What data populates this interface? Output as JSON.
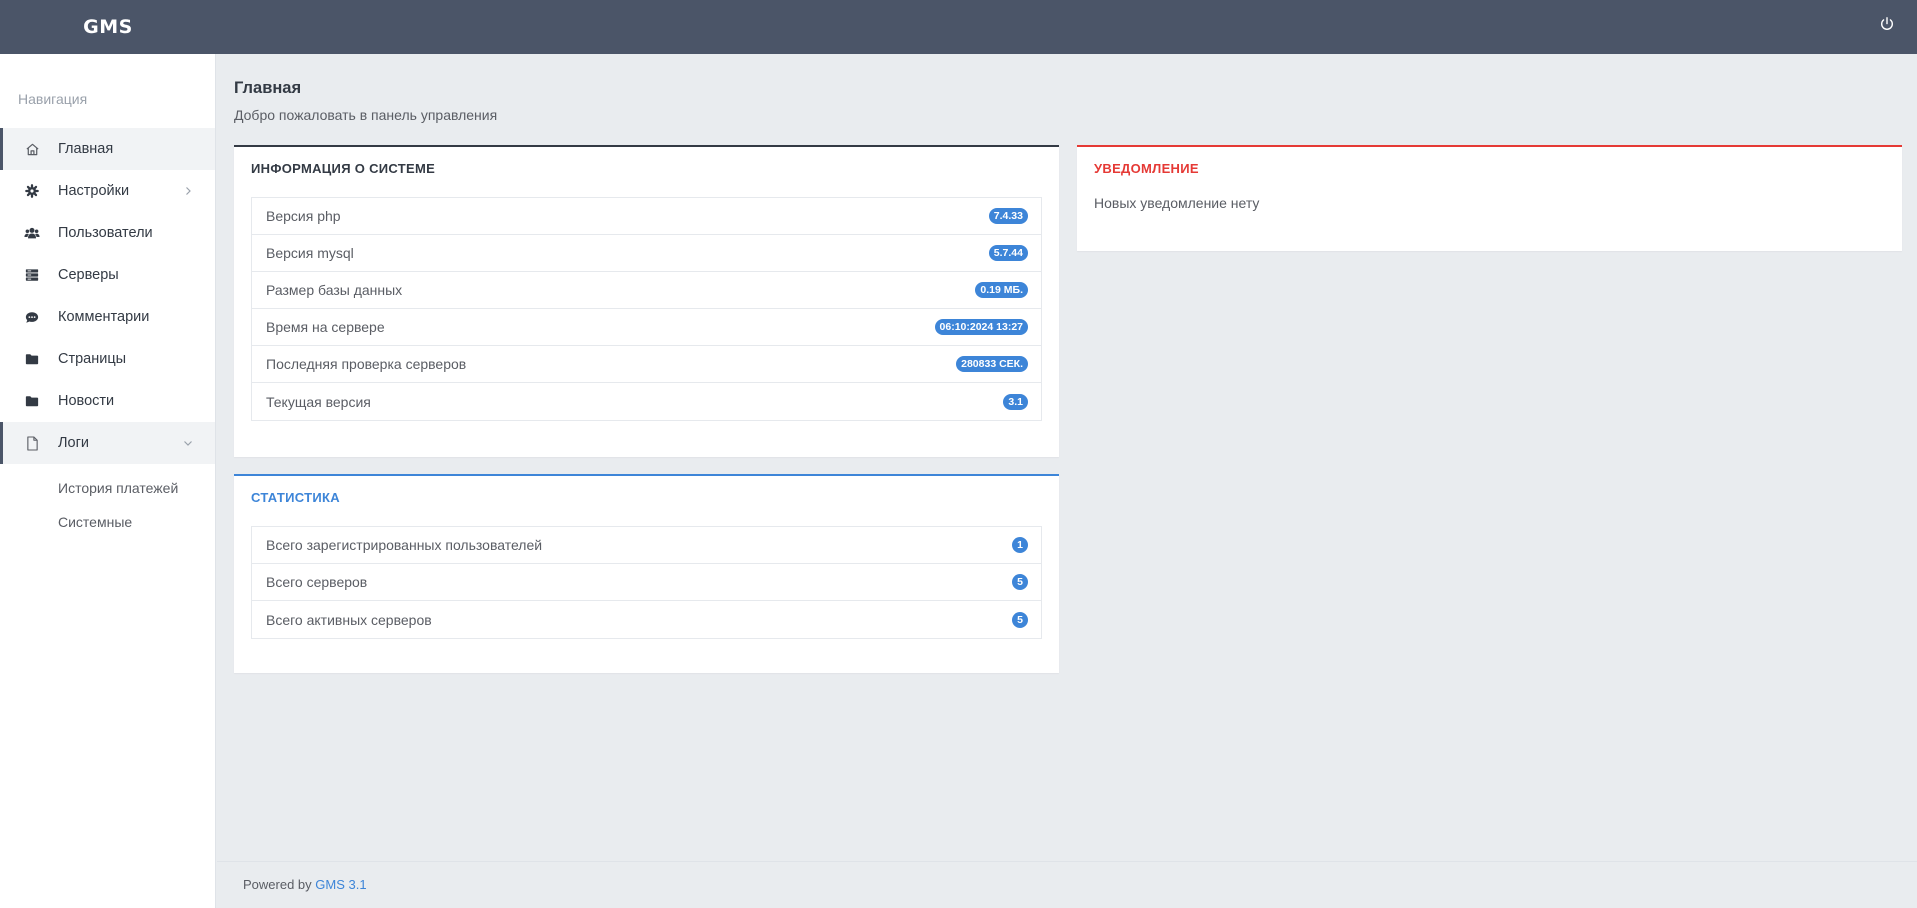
{
  "app": {
    "brand": "GMS"
  },
  "colors": {
    "topbar": "#4b5568",
    "accent": "#3d85d8",
    "danger": "#e53935",
    "dark": "#333a44"
  },
  "sidebar": {
    "heading": "Навигация",
    "items": [
      {
        "label": "Главная",
        "icon": "home-icon"
      },
      {
        "label": "Настройки",
        "icon": "gear-icon"
      },
      {
        "label": "Пользователи",
        "icon": "users-icon"
      },
      {
        "label": "Серверы",
        "icon": "server-icon"
      },
      {
        "label": "Комментарии",
        "icon": "comments-icon"
      },
      {
        "label": "Страницы",
        "icon": "folder-icon"
      },
      {
        "label": "Новости",
        "icon": "folder-icon"
      },
      {
        "label": "Логи",
        "icon": "file-icon"
      }
    ],
    "logs_sub": [
      {
        "label": "История платежей"
      },
      {
        "label": "Системные"
      }
    ]
  },
  "header": {
    "title": "Главная",
    "subtitle": "Добро пожаловать в панель управления"
  },
  "system_info": {
    "title": "ИНФОРМАЦИЯ О СИСТЕМЕ",
    "rows": [
      {
        "label": "Версия php",
        "value": "7.4.33"
      },
      {
        "label": "Версия mysql",
        "value": "5.7.44"
      },
      {
        "label": "Размер базы данных",
        "value": "0.19 МБ."
      },
      {
        "label": "Время на сервере",
        "value": "06:10:2024 13:27"
      },
      {
        "label": "Последняя проверка серверов",
        "value": "280833 СЕК."
      },
      {
        "label": "Текущая версия",
        "value": "3.1"
      }
    ]
  },
  "notifications": {
    "title": "УВЕДОМЛЕНИЕ",
    "text": "Новых уведомление нету"
  },
  "statistics": {
    "title": "СТАТИСТИКА",
    "rows": [
      {
        "label": "Всего зарегистрированных пользователей",
        "value": "1"
      },
      {
        "label": "Всего серверов",
        "value": "5"
      },
      {
        "label": "Всего активных серверов",
        "value": "5"
      }
    ]
  },
  "footer": {
    "prefix": "Powered by",
    "link": "GMS 3.1"
  }
}
